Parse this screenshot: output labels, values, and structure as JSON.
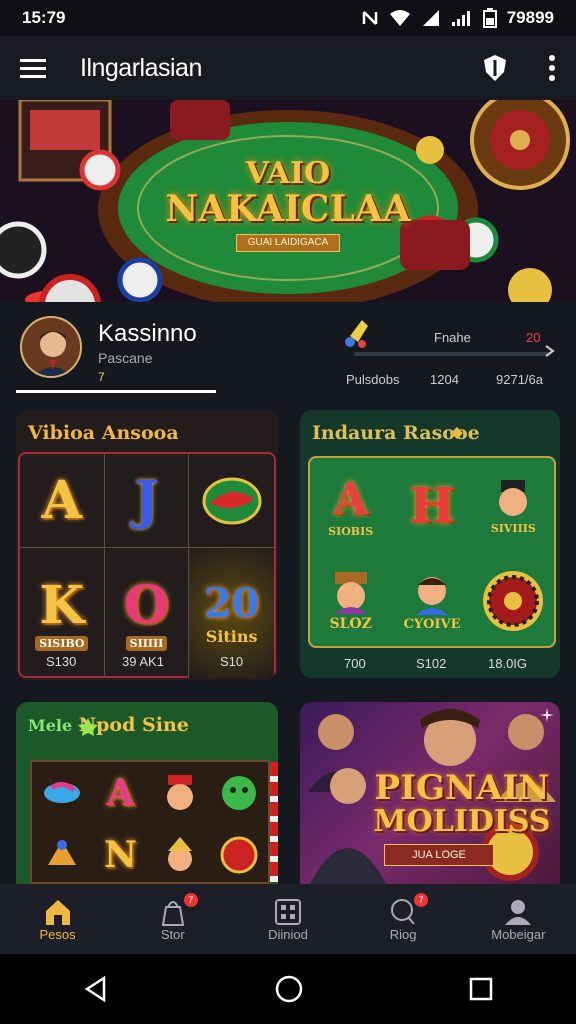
{
  "status_bar": {
    "time": "15:79",
    "battery": "79899",
    "icons": [
      "nfc-icon",
      "wifi-icon",
      "signal-icon",
      "signal-bars-icon",
      "battery-icon"
    ]
  },
  "app_bar": {
    "title": "Ilngarlasian",
    "icons": [
      "menu-icon",
      "shield-icon",
      "more-icon"
    ]
  },
  "hero": {
    "headline_line1": "VAIO",
    "headline_line2": "NAKAICLAA",
    "banner_text": "GUAI LAIDIGACA"
  },
  "profile": {
    "name": "Kassinno",
    "subtitle": "Pascane",
    "meta": "7"
  },
  "stats": {
    "label_left": "Fnahe",
    "label_right": "20",
    "values": [
      "Pulsdobs",
      "1204",
      "9271/6a"
    ]
  },
  "cards": {
    "card1": {
      "title": "Vibioa Ansooa",
      "cells": [
        "A",
        "J",
        "",
        "K",
        "O",
        "20"
      ],
      "sublabels": [
        "SISIBO",
        "SIIIII",
        "Sitins"
      ],
      "values": [
        "S130",
        "39 AK1",
        "S10"
      ]
    },
    "card2": {
      "title": "Indaura Rasooe",
      "cells": [
        "A",
        "H",
        "",
        "",
        "",
        ""
      ],
      "cell_labels": [
        "SIOBIS",
        "",
        "SIVIIIS",
        "SLOZ",
        "CYOIVE",
        ""
      ],
      "values": [
        "700",
        "S102",
        "18.0IG"
      ]
    },
    "card3": {
      "title_prefix": "Mele",
      "title_main": "Npod Sine",
      "cells": [
        "",
        "A",
        "",
        "",
        "N",
        "",
        "",
        "",
        ""
      ]
    },
    "card4": {
      "headline_line1": "PIGNAIN",
      "headline_line2": "MOLIDISS",
      "banner_text": "JUA LOGE"
    }
  },
  "bottom_nav": [
    {
      "label": "Pesos",
      "icon": "home-icon",
      "active": true,
      "badge": ""
    },
    {
      "label": "Stor",
      "icon": "bag-icon",
      "active": false,
      "badge": "7"
    },
    {
      "label": "Diiniod",
      "icon": "grid-icon",
      "active": false,
      "badge": ""
    },
    {
      "label": "Riog",
      "icon": "chat-icon",
      "active": false,
      "badge": "7"
    },
    {
      "label": "Mobeigar",
      "icon": "user-icon",
      "active": false,
      "badge": ""
    }
  ],
  "colors": {
    "accent": "#f0b840",
    "bg": "#15181f",
    "felt": "#1e8a3a",
    "badge": "#e33333"
  }
}
